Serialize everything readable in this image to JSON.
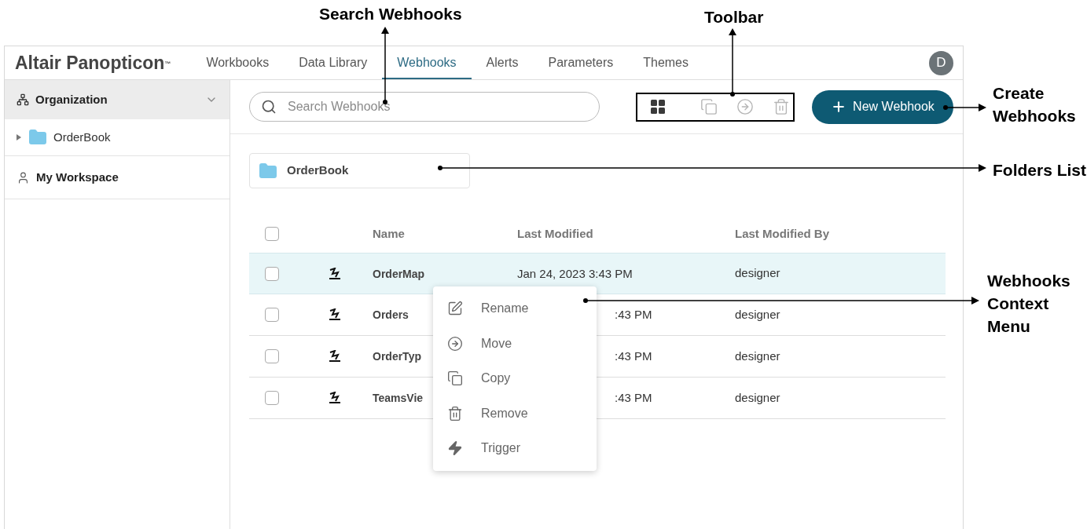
{
  "callouts": {
    "search": "Search Webhooks",
    "toolbar": "Toolbar",
    "create": "Create Webhooks",
    "folders": "Folders List",
    "menu": "Webhooks Context Menu"
  },
  "header": {
    "logo": "Altair Panopticon",
    "logo_mark": "™",
    "avatar": "D"
  },
  "tabs": [
    {
      "label": "Workbooks",
      "selected": false
    },
    {
      "label": "Data Library",
      "selected": false
    },
    {
      "label": "Webhooks",
      "selected": true
    },
    {
      "label": "Alerts",
      "selected": false
    },
    {
      "label": "Parameters",
      "selected": false
    },
    {
      "label": "Themes",
      "selected": false
    }
  ],
  "sidebar": {
    "sections": [
      {
        "label": "Organization",
        "kind": "org",
        "expanded": true,
        "children": [
          {
            "label": "OrderBook",
            "expanded": false
          }
        ]
      },
      {
        "label": "My Workspace",
        "kind": "user",
        "expanded": false
      }
    ]
  },
  "search": {
    "placeholder": "Search Webhooks"
  },
  "toolbar": [
    {
      "kind": "grid",
      "disabled": false
    },
    {
      "kind": "copy",
      "disabled": true
    },
    {
      "kind": "move",
      "disabled": true
    },
    {
      "kind": "delete",
      "disabled": true
    }
  ],
  "new_button": {
    "label": "New Webhook"
  },
  "folders": [
    {
      "label": "OrderBook"
    }
  ],
  "table": {
    "all_checked": false,
    "columns": [
      "Name",
      "Last Modified",
      "Last Modified By"
    ],
    "rows": [
      {
        "checked": false,
        "selected": true,
        "under_menu": false,
        "name": "OrderMap",
        "modified": "Jan 24, 2023 3:43 PM",
        "by": "designer"
      },
      {
        "checked": false,
        "selected": false,
        "under_menu": true,
        "name": "Orders",
        "modified": ":43 PM",
        "by": "designer"
      },
      {
        "checked": false,
        "selected": false,
        "under_menu": true,
        "name": "OrderTyp",
        "modified": ":43 PM",
        "by": "designer"
      },
      {
        "checked": false,
        "selected": false,
        "under_menu": true,
        "name": "TeamsVie",
        "modified": ":43 PM",
        "by": "designer"
      }
    ]
  },
  "context_menu": [
    {
      "kind": "rename",
      "label": "Rename"
    },
    {
      "kind": "move",
      "label": "Move"
    },
    {
      "kind": "copy",
      "label": "Copy"
    },
    {
      "kind": "remove",
      "label": "Remove"
    },
    {
      "kind": "trigger",
      "label": "Trigger"
    }
  ]
}
